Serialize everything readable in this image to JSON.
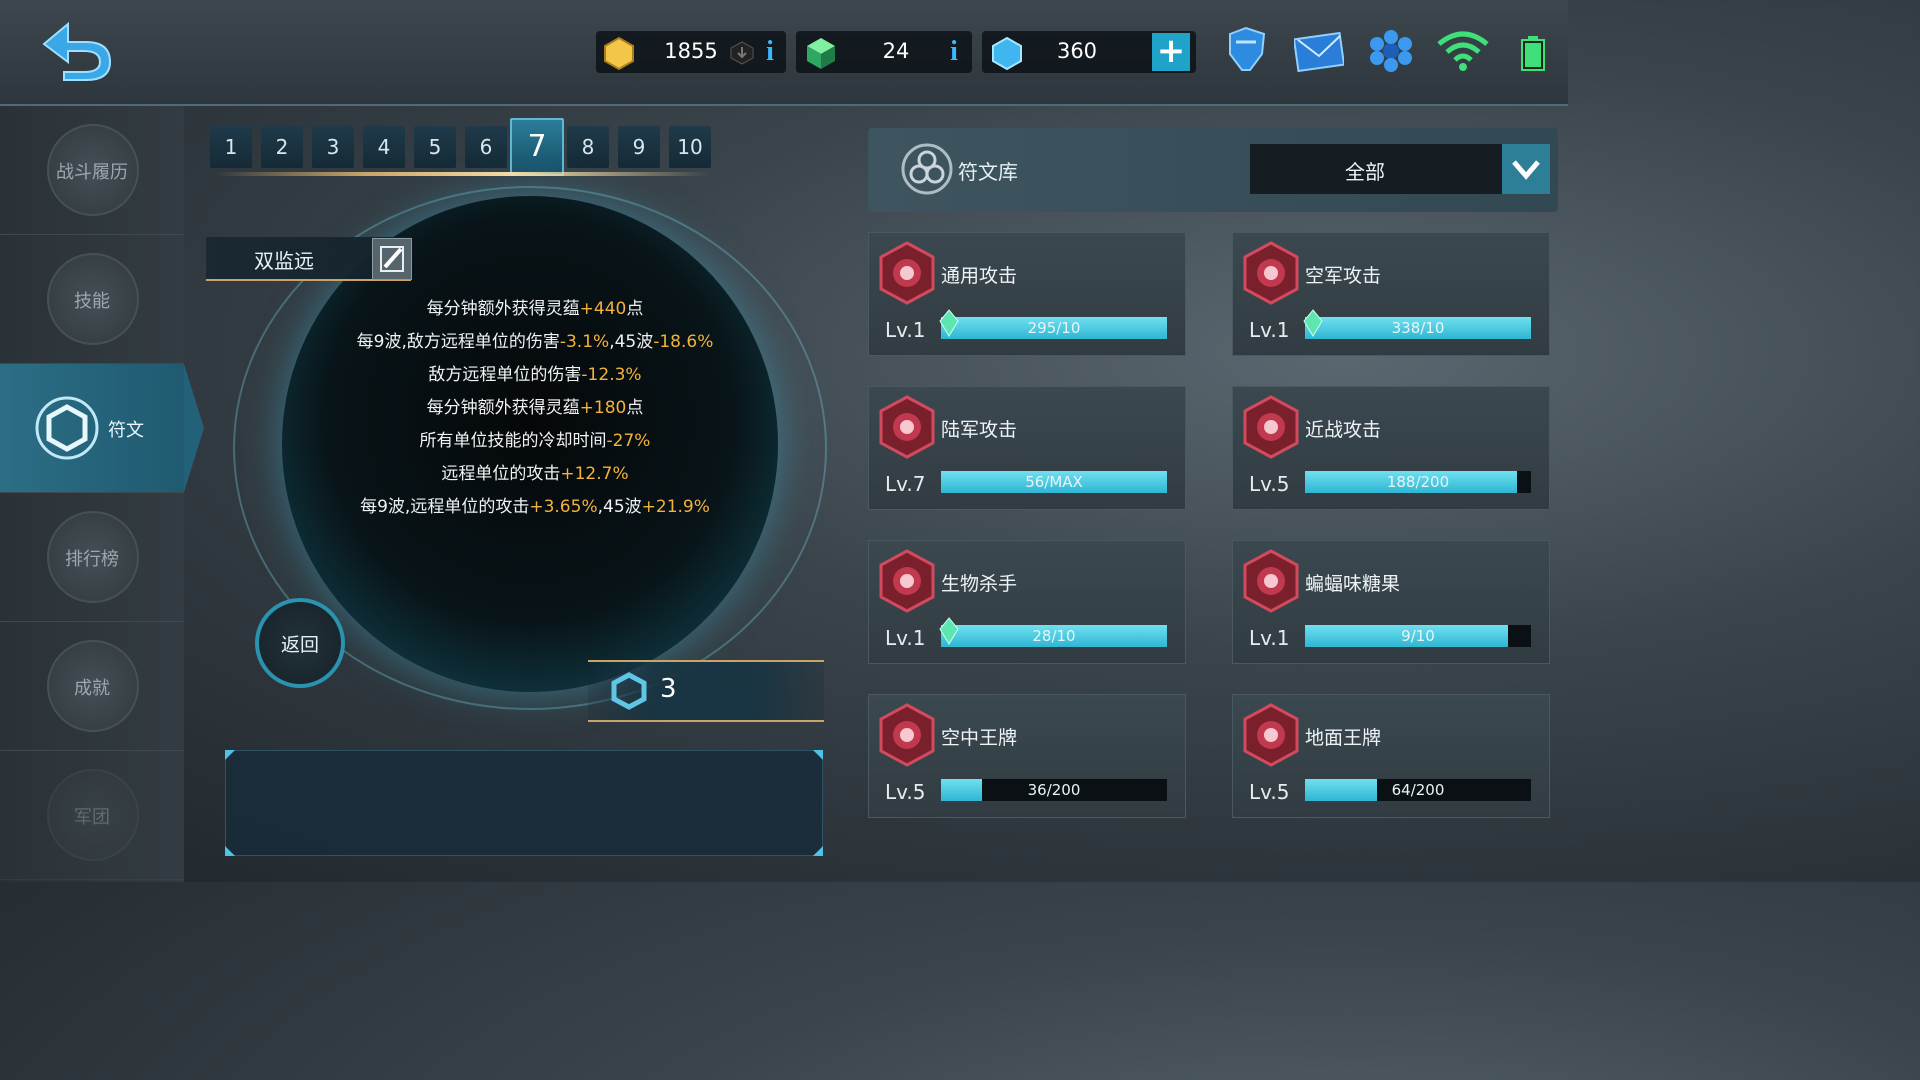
{
  "topbar": {
    "resources": [
      {
        "icon": "gold-hexagon-icon",
        "value": "1855"
      },
      {
        "icon": "green-cube-icon",
        "value": "24"
      },
      {
        "icon": "blue-crystal-icon",
        "value": "360"
      }
    ],
    "info_glyph": "i",
    "add_glyph": "+"
  },
  "sidebar": {
    "items": [
      {
        "label": "战斗履历"
      },
      {
        "label": "技能"
      },
      {
        "label": "符文"
      },
      {
        "label": "排行榜"
      },
      {
        "label": "成就"
      },
      {
        "label": "军团"
      }
    ]
  },
  "tabs": [
    "1",
    "2",
    "3",
    "4",
    "5",
    "6",
    "7",
    "8",
    "9",
    "10"
  ],
  "active_tab": "7",
  "preset": {
    "name": "双监远",
    "effects": [
      {
        "text": "每分钟额外获得灵蕴",
        "h1": "+440",
        "mid": "点",
        "h2": ""
      },
      {
        "text": "每9波,敌方远程单位的伤害",
        "h1": "-3.1%",
        "mid": ",45波",
        "h2": "-18.6%"
      },
      {
        "text": "敌方远程单位的伤害",
        "h1": "-12.3%",
        "mid": "",
        "h2": ""
      },
      {
        "text": "每分钟额外获得灵蕴",
        "h1": "+180",
        "mid": "点",
        "h2": ""
      },
      {
        "text": "所有单位技能的冷却时间",
        "h1": "-27%",
        "mid": "",
        "h2": ""
      },
      {
        "text": "远程单位的攻击",
        "h1": "+12.7%",
        "mid": "",
        "h2": ""
      },
      {
        "text": "每9波,远程单位的攻击",
        "h1": "+3.65%",
        "mid": ",45波",
        "h2": "+21.9%"
      }
    ],
    "return_label": "返回",
    "rune_count": "3"
  },
  "library": {
    "title": "符文库",
    "filter": "全部",
    "cards": [
      {
        "name": "通用攻击",
        "level": "Lv.1",
        "progress": "295/10",
        "fraction": 1.0,
        "gem": true
      },
      {
        "name": "空军攻击",
        "level": "Lv.1",
        "progress": "338/10",
        "fraction": 1.0,
        "gem": true
      },
      {
        "name": "陆军攻击",
        "level": "Lv.7",
        "progress": "56/MAX",
        "fraction": 1.0,
        "gem": false
      },
      {
        "name": "近战攻击",
        "level": "Lv.5",
        "progress": "188/200",
        "fraction": 0.94,
        "gem": false
      },
      {
        "name": "生物杀手",
        "level": "Lv.1",
        "progress": "28/10",
        "fraction": 1.0,
        "gem": true
      },
      {
        "name": "蝙蝠味糖果",
        "level": "Lv.1",
        "progress": "9/10",
        "fraction": 0.9,
        "gem": false
      },
      {
        "name": "空中王牌",
        "level": "Lv.5",
        "progress": "36/200",
        "fraction": 0.18,
        "gem": false
      },
      {
        "name": "地面王牌",
        "level": "Lv.5",
        "progress": "64/200",
        "fraction": 0.32,
        "gem": false
      }
    ]
  },
  "colors": {
    "accent": "#2fb6d3",
    "highlight": "#f3b23a",
    "gold": "#c8a36a"
  }
}
